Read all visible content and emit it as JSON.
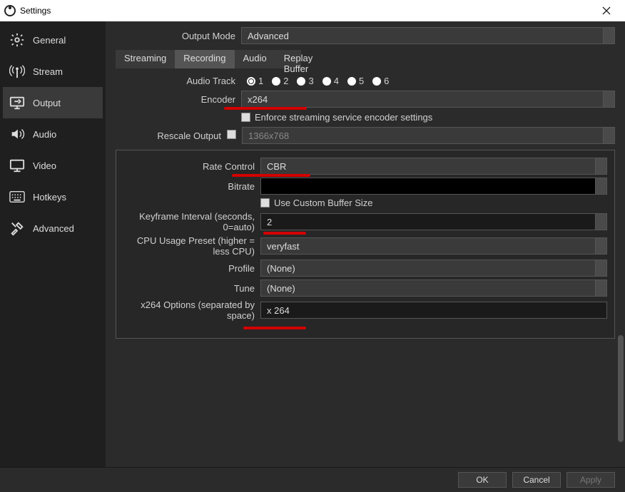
{
  "title": "Settings",
  "sidebar": {
    "items": [
      {
        "label": "General"
      },
      {
        "label": "Stream"
      },
      {
        "label": "Output"
      },
      {
        "label": "Audio"
      },
      {
        "label": "Video"
      },
      {
        "label": "Hotkeys"
      },
      {
        "label": "Advanced"
      }
    ],
    "selected_index": 2
  },
  "output_mode": {
    "label": "Output Mode",
    "value": "Advanced"
  },
  "tabs": [
    "Streaming",
    "Recording",
    "Audio",
    "Replay Buffer"
  ],
  "active_tab_index": 1,
  "audio_track": {
    "label": "Audio Track",
    "options": [
      "1",
      "2",
      "3",
      "4",
      "5",
      "6"
    ],
    "selected": "1"
  },
  "encoder": {
    "label": "Encoder",
    "value": "x264"
  },
  "enforce": {
    "label": "Enforce streaming service encoder settings",
    "checked": false
  },
  "rescale": {
    "label": "Rescale Output",
    "checked": false,
    "value": "1366x768"
  },
  "rate_control": {
    "label": "Rate Control",
    "value": "CBR"
  },
  "bitrate": {
    "label": "Bitrate",
    "value": ""
  },
  "custom_buffer": {
    "label": "Use Custom Buffer Size",
    "checked": false
  },
  "keyframe": {
    "label": "Keyframe Interval (seconds, 0=auto)",
    "value": "2"
  },
  "cpu_preset": {
    "label": "CPU Usage Preset (higher = less CPU)",
    "value": "veryfast"
  },
  "profile": {
    "label": "Profile",
    "value": "(None)"
  },
  "tune": {
    "label": "Tune",
    "value": "(None)"
  },
  "x264_opts": {
    "label": "x264 Options (separated by space)",
    "value": "x 264"
  },
  "footer": {
    "ok": "OK",
    "cancel": "Cancel",
    "apply": "Apply"
  }
}
